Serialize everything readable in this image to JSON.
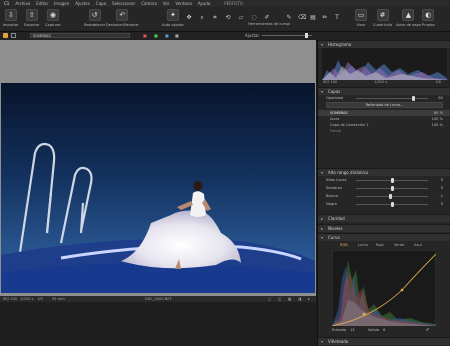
{
  "menu": {
    "app": "C1",
    "items": [
      "Archivo",
      "Editar",
      "Imagen",
      "Ajustes",
      "Capa",
      "Seleccionar",
      "Cámara",
      "Ver",
      "Ventana",
      "Ayuda"
    ],
    "window_title": "PERFOTO"
  },
  "toolbar": {
    "importar": "Importar",
    "exportar": "Exportar",
    "capturar": "Capturar",
    "restablecer": "Restablecer",
    "deshacer": "Deshacer/Rehacer",
    "auto_ajustar": "Auto ajustar",
    "herramientas": "Herramientas de cursor",
    "visor": "Visor",
    "cuadricula": "Cuadrícula",
    "aviso": "Aviso de expo",
    "prueba": "Prueba"
  },
  "subbar": {
    "layer_selected": "SOMBRAS",
    "ajustar": "Ajustar"
  },
  "status": {
    "iso": "ISO 100",
    "shutter": "1/320 s",
    "aperture": "f/5",
    "focal": "35 mm",
    "filename": "DSC_0000.NEF"
  },
  "histogram": {
    "title": "Histograma",
    "iso": "ISO 100",
    "shutter": "1/320 s",
    "fstop": "f/8"
  },
  "layers": {
    "title": "Capas",
    "opacity_label": "Opacidad",
    "opacity_value": "80",
    "opacity": 0.8,
    "mode_button": "Rellenado de Luma...",
    "items": [
      {
        "name": "SOMBRAS",
        "value": "80 %"
      },
      {
        "name": "luces",
        "value": "100 %"
      },
      {
        "name": "Capa de Corrección 1",
        "value": "100 %"
      },
      {
        "name": "Fondo",
        "value": ""
      }
    ]
  },
  "hdr_tool": {
    "title": "Alto rango dinámico",
    "rows": [
      {
        "label": "Altas Luces",
        "value": "0",
        "pos": 0.5
      },
      {
        "label": "Sombras",
        "value": "0",
        "pos": 0.5
      },
      {
        "label": "Blanco",
        "value": "-2",
        "pos": 0.48
      },
      {
        "label": "Negro",
        "value": "0",
        "pos": 0.5
      }
    ]
  },
  "collapsed": {
    "claridad": "Claridad",
    "niveles": "Niveles"
  },
  "curva": {
    "title": "Curva",
    "tabs": [
      "RGB",
      "Luma",
      "Rojo",
      "Verde",
      "Azul"
    ],
    "entrada_label": "Entrada",
    "entrada_value": "13",
    "salida_label": "Salida",
    "salida_value": "6"
  },
  "vinetado": {
    "title": "Viñeteado"
  },
  "colors": {
    "sky_top": "#0a1630",
    "sky_mid": "#1d4a8a",
    "accent": "#e8b24a"
  }
}
